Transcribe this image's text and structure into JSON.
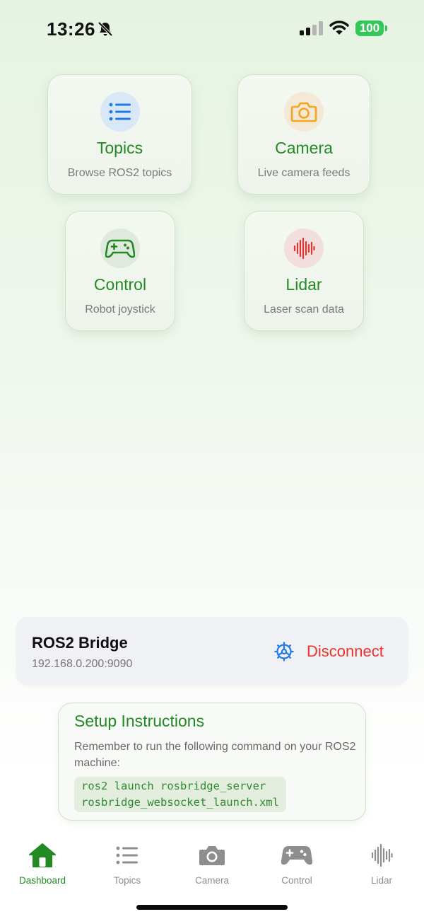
{
  "status_bar": {
    "time": "13:26",
    "battery": "100"
  },
  "tiles": [
    {
      "title": "Topics",
      "subtitle": "Browse ROS2 topics",
      "icon": "list-icon"
    },
    {
      "title": "Camera",
      "subtitle": "Live camera feeds",
      "icon": "camera-icon"
    },
    {
      "title": "Control",
      "subtitle": "Robot joystick",
      "icon": "gamepad-icon"
    },
    {
      "title": "Lidar",
      "subtitle": "Laser scan data",
      "icon": "waveform-icon"
    }
  ],
  "bridge": {
    "title": "ROS2 Bridge",
    "address": "192.168.0.200:9090",
    "disconnect_label": "Disconnect"
  },
  "setup": {
    "title": "Setup Instructions",
    "text": "Remember to run the following command on your ROS2 machine:",
    "code_line1": "ros2 launch rosbridge_server",
    "code_line2": "rosbridge_websocket_launch.xml"
  },
  "tabs": [
    {
      "label": "Dashboard",
      "active": true
    },
    {
      "label": "Topics",
      "active": false
    },
    {
      "label": "Camera",
      "active": false
    },
    {
      "label": "Control",
      "active": false
    },
    {
      "label": "Lidar",
      "active": false
    }
  ],
  "colors": {
    "accent_green": "#238a23",
    "destructive_red": "#e8332e",
    "link_blue": "#1f7ae8",
    "camera_orange": "#f3a51c",
    "lidar_red": "#d93a36"
  }
}
